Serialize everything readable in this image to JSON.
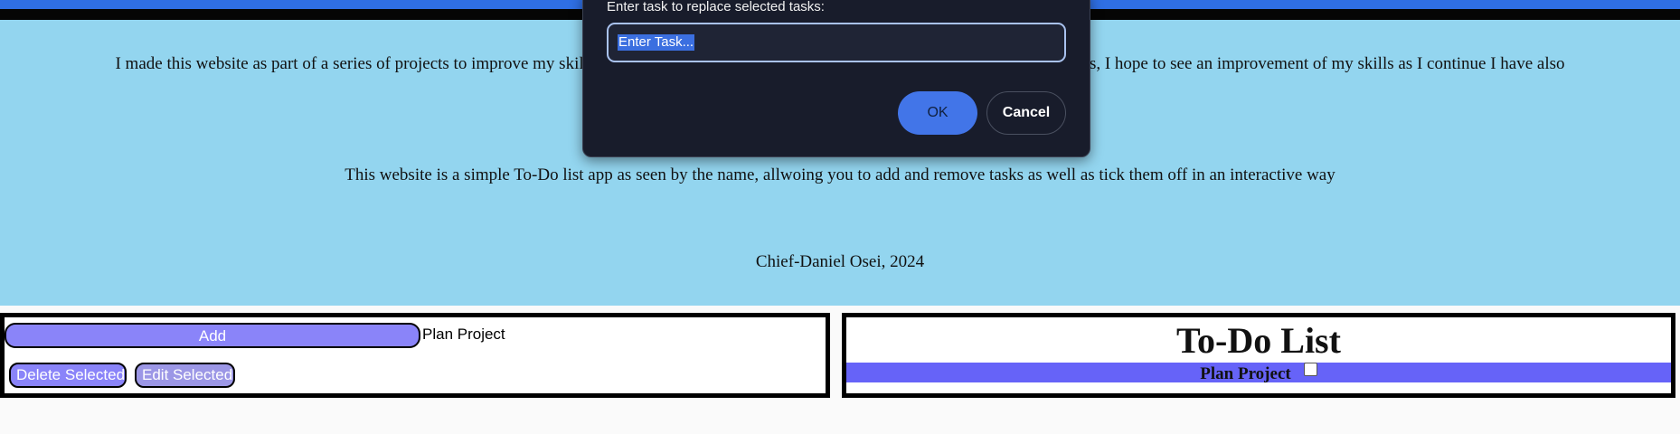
{
  "about": {
    "paragraph1": "I made this website as part of a series of projects to improve my skill and knowledge as a programmer. As this is one of the first of my projects, I hope to see an improvement of my skills as I continue I have also",
    "paragraph2": "This website is a simple To-Do list app as seen by the name, allwoing you to add and remove tasks as well as tick them off in an interactive way",
    "credit": "Chief-Daniel Osei, 2024"
  },
  "controls": {
    "add_label": "Add",
    "task_input_value": "Plan Project",
    "delete_label": "Delete Selected",
    "edit_label": "Edit Selected"
  },
  "todo": {
    "title": "To-Do List",
    "tasks": [
      {
        "label": "Plan Project",
        "checked": false
      }
    ]
  },
  "dialog": {
    "message": "Enter task to replace selected tasks:",
    "input_value": "Enter Task...",
    "ok_label": "OK",
    "cancel_label": "Cancel"
  },
  "colors": {
    "top_bar": "#2f6fe4",
    "about_bg": "#93d5ef",
    "button_bg": "#8a84f9",
    "task_row_bg": "#6663f8",
    "dialog_bg": "#181c2b",
    "ok_button": "#4275e8"
  }
}
